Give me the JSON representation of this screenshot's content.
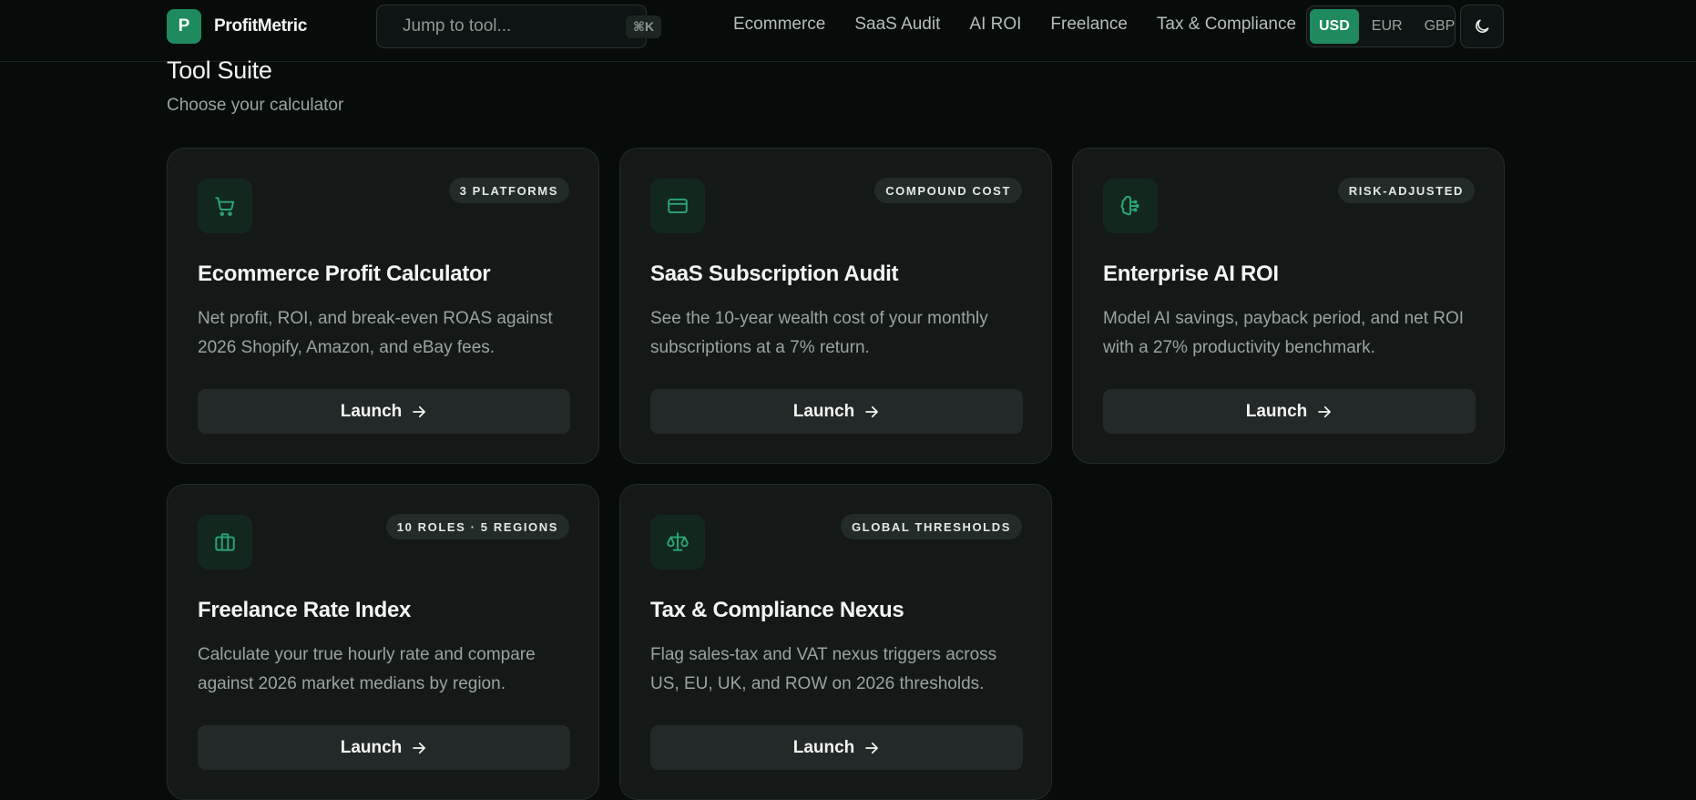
{
  "header": {
    "logo_letter": "P",
    "brand": "ProfitMetric",
    "search_placeholder": "Jump to tool...",
    "search_shortcut": "⌘K",
    "nav": [
      "Ecommerce",
      "SaaS Audit",
      "AI ROI",
      "Freelance",
      "Tax & Compliance"
    ],
    "currencies": [
      "USD",
      "EUR",
      "GBP"
    ],
    "active_currency": "USD",
    "theme_icon": "moon-icon"
  },
  "main": {
    "title": "Tool Suite",
    "subtitle": "Choose your calculator",
    "cards": [
      {
        "icon": "cart-icon",
        "badge": "3 PLATFORMS",
        "title": "Ecommerce Profit Calculator",
        "description": "Net profit, ROI, and break-even ROAS against 2026 Shopify, Amazon, and eBay fees.",
        "button": "Launch"
      },
      {
        "icon": "credit-card-icon",
        "badge": "COMPOUND COST",
        "title": "SaaS Subscription Audit",
        "description": "See the 10-year wealth cost of your monthly subscriptions at a 7% return.",
        "button": "Launch"
      },
      {
        "icon": "brain-icon",
        "badge": "RISK-ADJUSTED",
        "title": "Enterprise AI ROI",
        "description": "Model AI savings, payback period, and net ROI with a 27% productivity benchmark.",
        "button": "Launch"
      },
      {
        "icon": "briefcase-icon",
        "badge": "10 ROLES · 5 REGIONS",
        "title": "Freelance Rate Index",
        "description": "Calculate your true hourly rate and compare against 2026 market medians by region.",
        "button": "Launch"
      },
      {
        "icon": "scale-icon",
        "badge": "GLOBAL THRESHOLDS",
        "title": "Tax & Compliance Nexus",
        "description": "Flag sales-tax and VAT nexus triggers across US, EU, UK, and ROW on 2026 thresholds.",
        "button": "Launch"
      }
    ]
  },
  "colors": {
    "accent": "#1e8a5e",
    "background": "#070c0b",
    "card": "#141918"
  }
}
